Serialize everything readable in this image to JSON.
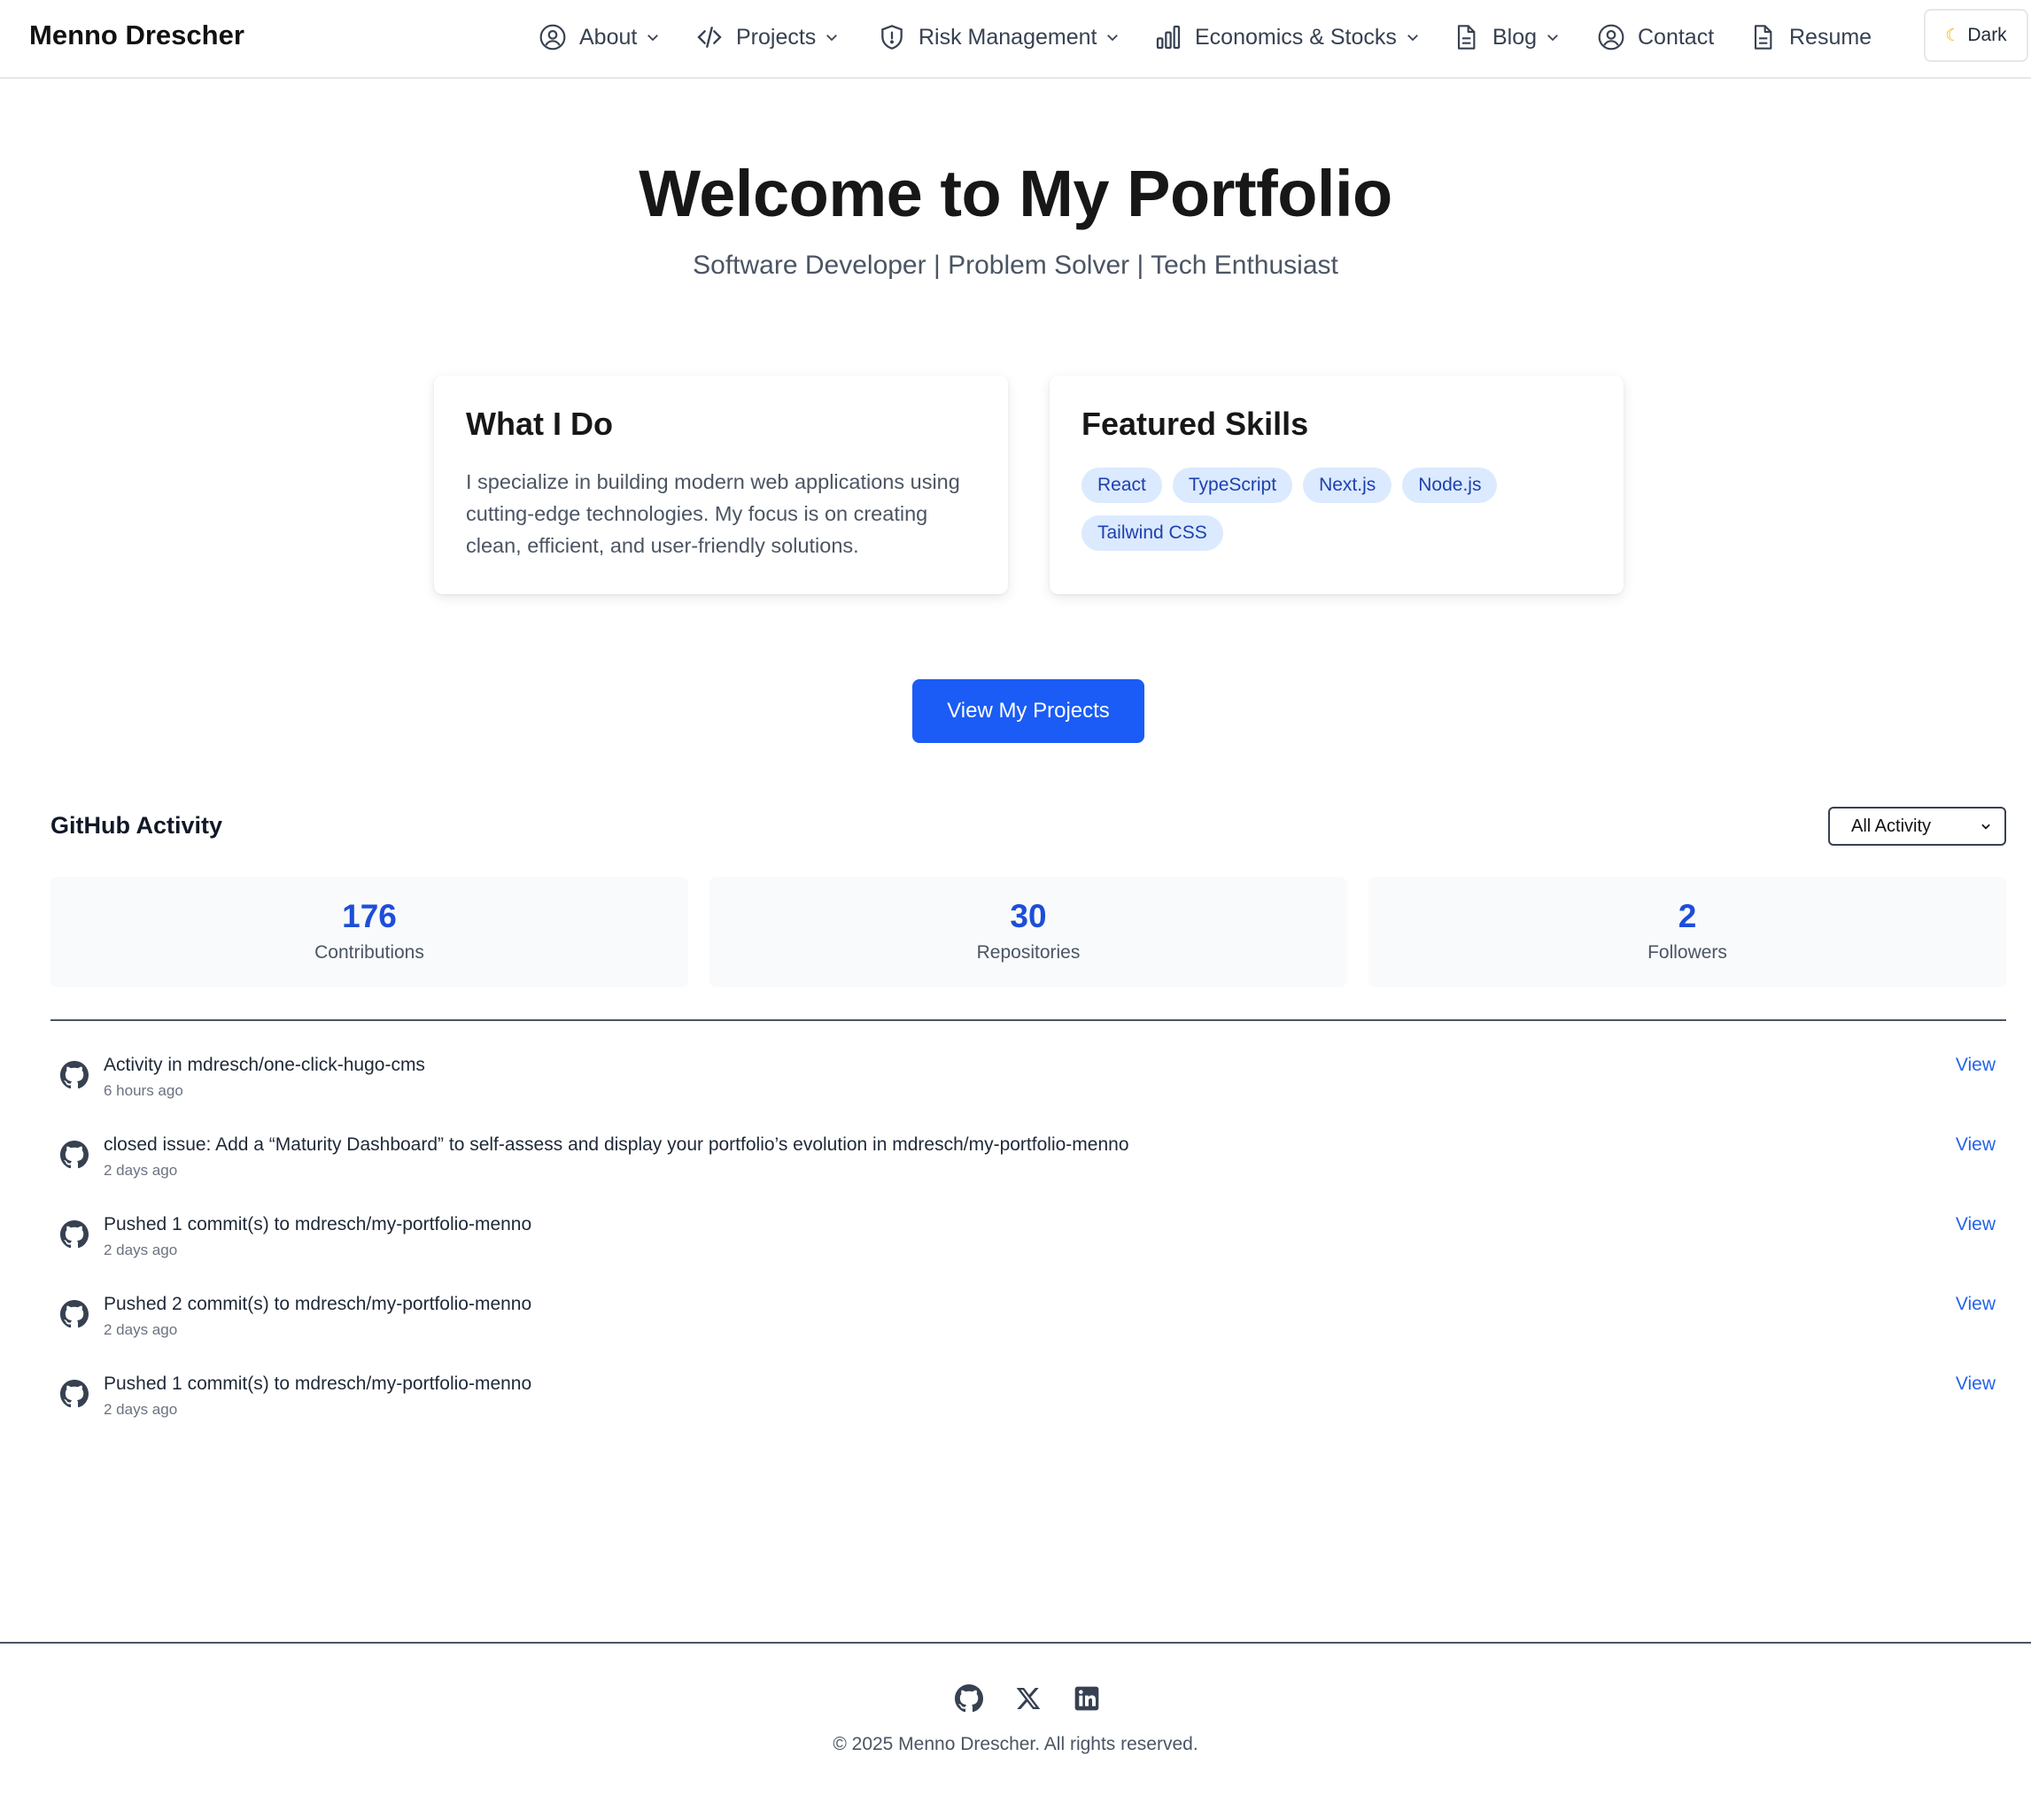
{
  "header": {
    "brand": "Menno Drescher",
    "nav": [
      {
        "label": "About",
        "icon": "user-circle-icon",
        "dropdown": true
      },
      {
        "label": "Projects",
        "icon": "code-icon",
        "dropdown": true
      },
      {
        "label": "Risk Management",
        "icon": "shield-alert-icon",
        "dropdown": true
      },
      {
        "label": "Economics & Stocks",
        "icon": "bar-chart-icon",
        "dropdown": true
      },
      {
        "label": "Blog",
        "icon": "document-icon",
        "dropdown": true
      },
      {
        "label": "Contact",
        "icon": "user-circle-icon",
        "dropdown": false
      },
      {
        "label": "Resume",
        "icon": "document-icon",
        "dropdown": false
      }
    ],
    "theme_toggle": {
      "label": "Dark",
      "icon": "moon-icon"
    }
  },
  "hero": {
    "title": "Welcome to My Portfolio",
    "subtitle": "Software Developer | Problem Solver | Tech Enthusiast"
  },
  "cards": {
    "what_i_do": {
      "title": "What I Do",
      "text": "I specialize in building modern web applications using cutting-edge technologies. My focus is on creating clean, efficient, and user-friendly solutions."
    },
    "skills": {
      "title": "Featured Skills",
      "tags": [
        "React",
        "TypeScript",
        "Next.js",
        "Node.js",
        "Tailwind CSS"
      ]
    }
  },
  "cta": {
    "label": "View My Projects"
  },
  "github": {
    "title": "GitHub Activity",
    "filter": {
      "selected": "All Activity"
    },
    "stats": [
      {
        "value": "176",
        "label": "Contributions"
      },
      {
        "value": "30",
        "label": "Repositories"
      },
      {
        "value": "2",
        "label": "Followers"
      }
    ],
    "activity": [
      {
        "title": "Activity in mdresch/one-click-hugo-cms",
        "time": "6 hours ago",
        "action": "View"
      },
      {
        "title": "closed issue: Add a “Maturity Dashboard” to self-assess and display your portfolio’s evolution in mdresch/my-portfolio-menno",
        "time": "2 days ago",
        "action": "View"
      },
      {
        "title": "Pushed 1 commit(s) to mdresch/my-portfolio-menno",
        "time": "2 days ago",
        "action": "View"
      },
      {
        "title": "Pushed 2 commit(s) to mdresch/my-portfolio-menno",
        "time": "2 days ago",
        "action": "View"
      },
      {
        "title": "Pushed 1 commit(s) to mdresch/my-portfolio-menno",
        "time": "2 days ago",
        "action": "View"
      }
    ]
  },
  "footer": {
    "social": [
      "github-icon",
      "x-icon",
      "linkedin-icon"
    ],
    "copyright": "© 2025 Menno Drescher. All rights reserved."
  },
  "colors": {
    "accent": "#1a5cf5",
    "stat_number": "#1d4ed8",
    "tag_bg": "#dbeafe",
    "tag_text": "#1e40af",
    "link": "#2563eb"
  }
}
